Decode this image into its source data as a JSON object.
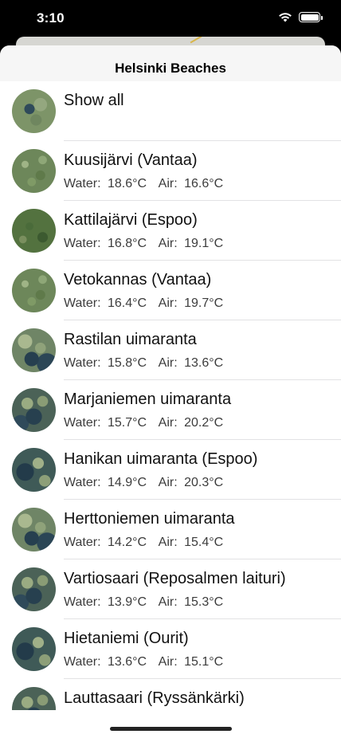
{
  "status": {
    "time": "3:10"
  },
  "nav": {
    "title": "Helsinki Beaches"
  },
  "show_all": {
    "label": "Show all"
  },
  "labels": {
    "water": "Water:",
    "air": "Air:"
  },
  "beaches": [
    {
      "name": "Kuusijärvi (Vantaa)",
      "water": "18.6°C",
      "air": "16.6°C"
    },
    {
      "name": "Kattilajärvi (Espoo)",
      "water": "16.8°C",
      "air": "19.1°C"
    },
    {
      "name": "Vetokannas (Vantaa)",
      "water": "16.4°C",
      "air": "19.7°C"
    },
    {
      "name": "Rastilan uimaranta",
      "water": "15.8°C",
      "air": "13.6°C"
    },
    {
      "name": "Marjaniemen uimaranta",
      "water": "15.7°C",
      "air": "20.2°C"
    },
    {
      "name": "Hanikan uimaranta (Espoo)",
      "water": "14.9°C",
      "air": "20.3°C"
    },
    {
      "name": "Herttoniemen uimaranta",
      "water": "14.2°C",
      "air": "15.4°C"
    },
    {
      "name": "Vartiosaari (Reposalmen laituri)",
      "water": "13.9°C",
      "air": "15.3°C"
    },
    {
      "name": "Hietaniemi (Ourit)",
      "water": "13.6°C",
      "air": "15.1°C"
    },
    {
      "name": "Lauttasaari (Ryssänkärki)",
      "water": "",
      "air": ""
    }
  ]
}
